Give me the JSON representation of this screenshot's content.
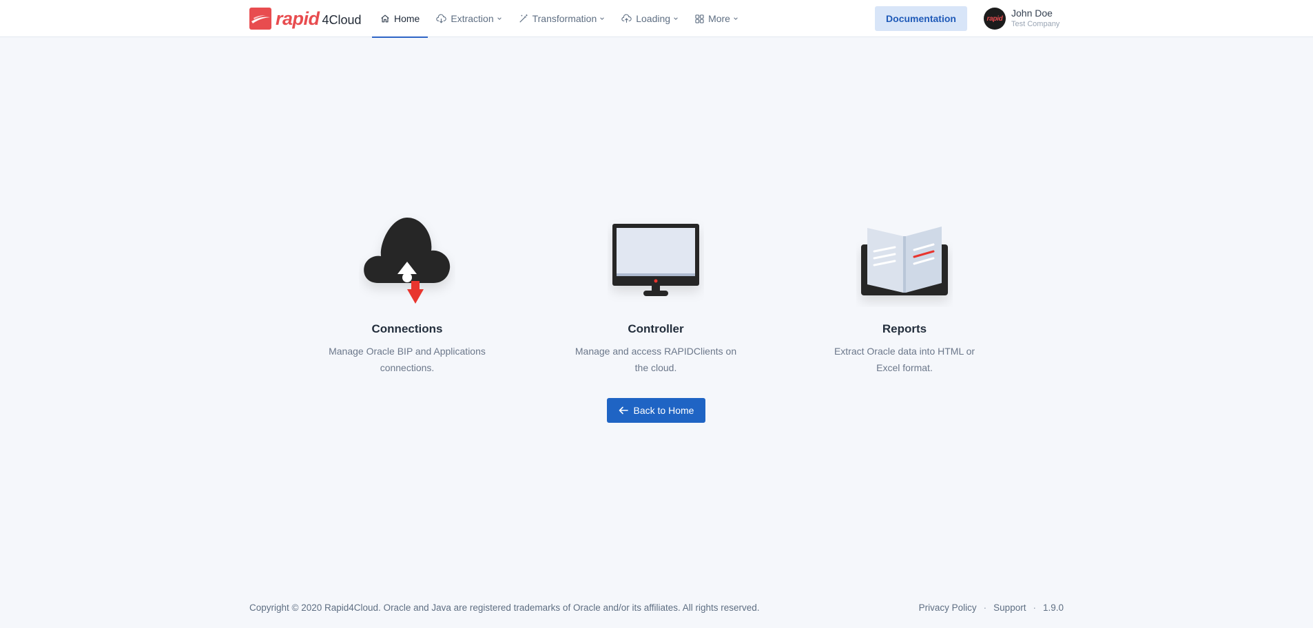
{
  "brand": {
    "word": "rapid",
    "suffix": "4Cloud",
    "color": "#e84c4f"
  },
  "nav": {
    "items": [
      {
        "label": "Home",
        "icon": "home-icon",
        "active": true
      },
      {
        "label": "Extraction",
        "icon": "cloud-download-icon",
        "dropdown": true
      },
      {
        "label": "Transformation",
        "icon": "magic-wand-icon",
        "dropdown": true
      },
      {
        "label": "Loading",
        "icon": "cloud-upload-icon",
        "dropdown": true
      },
      {
        "label": "More",
        "icon": "grid-icon",
        "dropdown": true
      }
    ]
  },
  "header": {
    "documentation_label": "Documentation"
  },
  "user": {
    "name": "John Doe",
    "company": "Test Company",
    "avatar_text": "rapid"
  },
  "cards": [
    {
      "title": "Connections",
      "description": "Manage Oracle BIP and Applications connections.",
      "icon": "cloud-sync-icon"
    },
    {
      "title": "Controller",
      "description": "Manage and access RAPIDClients on the cloud.",
      "icon": "monitor-icon"
    },
    {
      "title": "Reports",
      "description": "Extract Oracle data into HTML or Excel format.",
      "icon": "open-book-icon"
    }
  ],
  "back_button": {
    "label": "Back to Home",
    "icon": "arrow-left-icon"
  },
  "footer": {
    "copyright": "Copyright © 2020 Rapid4Cloud. Oracle and Java are registered trademarks of Oracle and/or its affiliates. All rights reserved.",
    "privacy": "Privacy Policy",
    "support": "Support",
    "version": "1.9.0",
    "separator": "·"
  },
  "colors": {
    "accent": "#1f64c4",
    "doc_button_bg": "#d8e5f8",
    "page_bg": "#f5f7fb",
    "icon_red": "#e8352e"
  }
}
